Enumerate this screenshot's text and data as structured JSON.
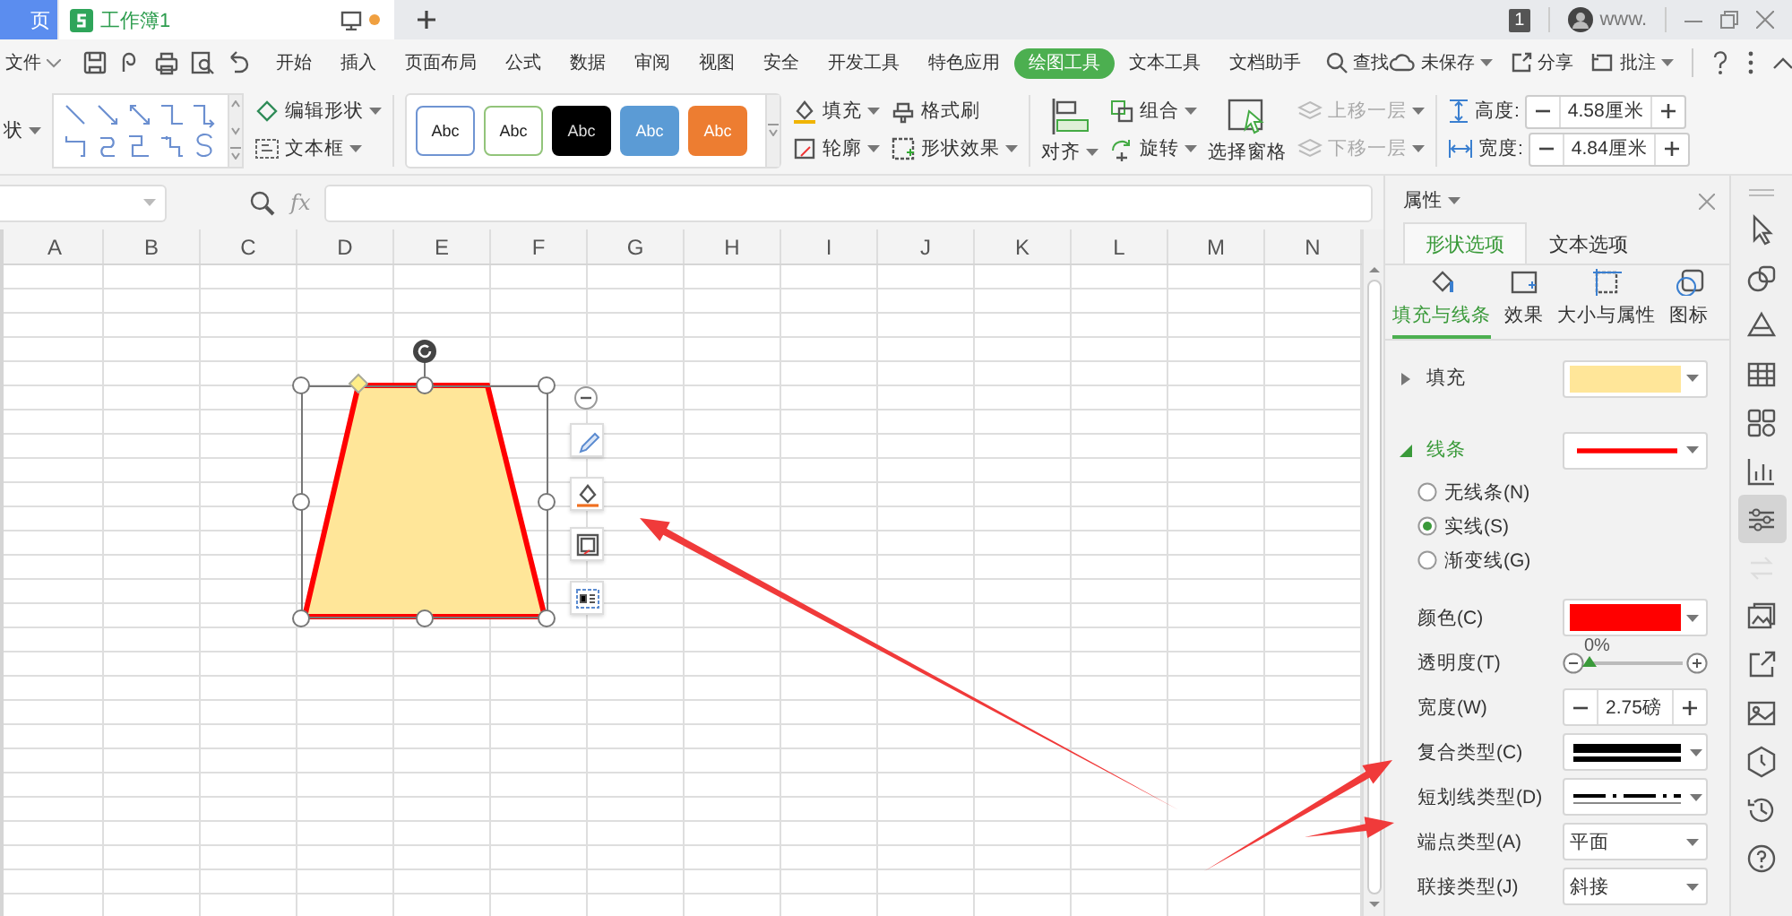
{
  "tabs": [
    {
      "label": "页",
      "kind": "home",
      "selected": false
    },
    {
      "label": "工作簿1",
      "kind": "sheet",
      "selected": true,
      "unsaved": true
    }
  ],
  "account": {
    "badge": "1",
    "name": "www."
  },
  "menu": {
    "file": "文件",
    "items": [
      {
        "label": "开始",
        "selected": false
      },
      {
        "label": "插入",
        "selected": false
      },
      {
        "label": "页面布局",
        "selected": false
      },
      {
        "label": "公式",
        "selected": false
      },
      {
        "label": "数据",
        "selected": false
      },
      {
        "label": "审阅",
        "selected": false
      },
      {
        "label": "视图",
        "selected": false
      },
      {
        "label": "安全",
        "selected": false
      },
      {
        "label": "开发工具",
        "selected": false
      },
      {
        "label": "特色应用",
        "selected": false
      },
      {
        "label": "绘图工具",
        "selected": true
      },
      {
        "label": "文本工具",
        "selected": false
      },
      {
        "label": "文档助手",
        "selected": false
      }
    ],
    "search": "查找",
    "save_state": "未保存",
    "share": "分享",
    "comment": "批注"
  },
  "ribbon": {
    "shapes_label": "状",
    "edit_shape": "编辑形状",
    "text_box": "文本框",
    "styles": [
      {
        "label": "Abc",
        "kind": "outline",
        "color": "#6f94d2"
      },
      {
        "label": "Abc",
        "kind": "outline",
        "color": "#92c47a"
      },
      {
        "label": "Abc",
        "kind": "solid",
        "color": "#000000"
      },
      {
        "label": "Abc",
        "kind": "solid",
        "color": "#5b9bd5"
      },
      {
        "label": "Abc",
        "kind": "solid",
        "color": "#ed7d31"
      }
    ],
    "fill": "填充",
    "outline": "轮廓",
    "format_painter": "格式刷",
    "shape_effects": "形状效果",
    "align": "对齐",
    "group": "组合",
    "rotate": "旋转",
    "selection_pane": "选择窗格",
    "bring_forward": {
      "label": "上移一层",
      "disabled": true
    },
    "send_backward": {
      "label": "下移一层",
      "disabled": true
    },
    "height": {
      "label": "高度:",
      "value": "4.58厘米"
    },
    "width": {
      "label": "宽度:",
      "value": "4.84厘米"
    }
  },
  "formula_bar": {
    "fx": "fx"
  },
  "sheet": {
    "columns": [
      "A",
      "B",
      "C",
      "D",
      "E",
      "F",
      "G",
      "H",
      "I",
      "J",
      "K",
      "L",
      "M",
      "N"
    ],
    "shape": {
      "kind": "trapezoid",
      "selected": true
    }
  },
  "panel": {
    "title": "属性",
    "tabs": [
      {
        "label": "形状选项",
        "selected": true
      },
      {
        "label": "文本选项",
        "selected": false
      }
    ],
    "subtabs": [
      {
        "label": "填充与线条",
        "kind": "fill-line",
        "selected": true
      },
      {
        "label": "效果",
        "kind": "effects",
        "selected": false
      },
      {
        "label": "大小与属性",
        "kind": "size",
        "selected": false
      },
      {
        "label": "图标",
        "kind": "icon",
        "selected": false
      }
    ],
    "fill": {
      "label": "填充",
      "expanded": false,
      "color": "#ffe699"
    },
    "line": {
      "label": "线条",
      "expanded": true,
      "color": "#ff0000",
      "types": [
        {
          "label": "无线条(N)",
          "selected": false
        },
        {
          "label": "实线(S)",
          "selected": true
        },
        {
          "label": "渐变线(G)",
          "selected": false
        }
      ],
      "color_label": "颜色(C)",
      "transparency": {
        "label": "透明度(T)",
        "reading": "0%",
        "level": 0
      },
      "width": {
        "label": "宽度(W)",
        "value": "2.75磅"
      },
      "compound": {
        "label": "复合类型(C)"
      },
      "dash": {
        "label": "短划线类型(D)"
      },
      "cap": {
        "label": "端点类型(A)",
        "value": "平面"
      },
      "join": {
        "label": "联接类型(J)",
        "value": "斜接"
      }
    }
  },
  "side_tools": [
    {
      "kind": "pointer",
      "selected": false,
      "disabled": false
    },
    {
      "kind": "shapes",
      "selected": false,
      "disabled": false
    },
    {
      "kind": "style",
      "selected": false,
      "disabled": false
    },
    {
      "kind": "table",
      "selected": false,
      "disabled": false
    },
    {
      "kind": "apps",
      "selected": false,
      "disabled": false
    },
    {
      "kind": "chart",
      "selected": false,
      "disabled": false
    },
    {
      "kind": "adjust",
      "selected": true,
      "disabled": false
    },
    {
      "kind": "swap",
      "selected": false,
      "disabled": true
    },
    {
      "kind": "gallery",
      "selected": false,
      "disabled": false
    },
    {
      "kind": "export",
      "selected": false,
      "disabled": false
    },
    {
      "kind": "image",
      "selected": false,
      "disabled": false
    },
    {
      "kind": "badge",
      "selected": false,
      "disabled": false
    },
    {
      "kind": "history",
      "selected": false,
      "disabled": false
    },
    {
      "kind": "help",
      "selected": false,
      "disabled": false
    }
  ]
}
